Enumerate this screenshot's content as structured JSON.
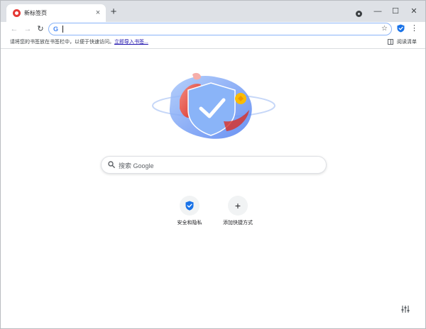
{
  "tab": {
    "title": "新标签页",
    "close_glyph": "×"
  },
  "tabstrip": {
    "new_tab_glyph": "+"
  },
  "window_controls": {
    "minimize_glyph": "—",
    "maximize_glyph": "☐",
    "close_glyph": "✕"
  },
  "toolbar": {
    "back_glyph": "←",
    "forward_glyph": "→",
    "reload_glyph": "↻",
    "omnibox_logo": "G",
    "star_glyph": "☆",
    "menu_glyph": "⋮"
  },
  "bookmark_bar": {
    "hint": "请将您的书签放在书签栏中，以便于快速访问。",
    "import_link": "立即导入书签...",
    "reading_list": "阅读清单"
  },
  "search": {
    "placeholder": "搜索 Google"
  },
  "shortcuts": [
    {
      "label": "安全和隐私",
      "icon": "shield-check-icon"
    },
    {
      "label": "添加快捷方式",
      "icon": "plus-icon",
      "glyph": "+"
    }
  ],
  "colors": {
    "accent": "#1a73e8",
    "tabstrip": "#dee1e6",
    "brand_red": "#e53935"
  }
}
